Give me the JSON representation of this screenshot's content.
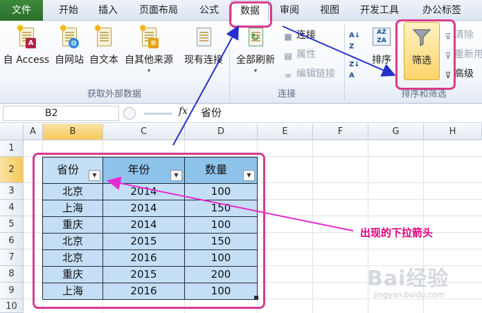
{
  "tabs": [
    "文件",
    "开始",
    "插入",
    "页面布局",
    "公式",
    "数据",
    "审阅",
    "视图",
    "开发工具",
    "办公标签"
  ],
  "ribbon": {
    "get_external": {
      "buttons": [
        "自 Access",
        "自网站",
        "自文本",
        "自其他来源",
        "现有连接"
      ],
      "group_label": "获取外部数据"
    },
    "connections": {
      "refresh_all": "全部刷新",
      "connect": "连接",
      "properties": "属性",
      "edit_links": "编辑链接",
      "group_label": "连接"
    },
    "sort_filter": {
      "sort": "排序",
      "filter": "筛选",
      "clear": "清除",
      "reapply": "重新用",
      "advanced": "高级",
      "group_label": "排序和筛选"
    }
  },
  "formula_bar": {
    "name_box": "B2",
    "fx": "fx",
    "content": "省份"
  },
  "grid": {
    "columns": [
      "A",
      "B",
      "C",
      "D",
      "E",
      "F",
      "G",
      "H"
    ],
    "rows": [
      "1",
      "2",
      "3",
      "4",
      "5",
      "6",
      "7",
      "8",
      "9",
      "10"
    ],
    "table": {
      "headers": [
        "省份",
        "年份",
        "数量"
      ],
      "data": [
        [
          "北京",
          "2014",
          "100"
        ],
        [
          "上海",
          "2014",
          "150"
        ],
        [
          "重庆",
          "2014",
          "100"
        ],
        [
          "北京",
          "2015",
          "150"
        ],
        [
          "北京",
          "2016",
          "100"
        ],
        [
          "重庆",
          "2015",
          "200"
        ],
        [
          "上海",
          "2016",
          "100"
        ]
      ]
    }
  },
  "annotation": {
    "text": "出现的下拉箭头",
    "color": "#e0007e"
  },
  "watermark": {
    "text": "Bai经验",
    "url": "jingyan.baidu.com"
  },
  "colors": {
    "callout": "#d73a8c",
    "arrow_blue": "#2430c8",
    "arrow_magenta": "#e62cd0",
    "header_fill": "#8ec3ec",
    "data_fill": "#c4dff5"
  }
}
